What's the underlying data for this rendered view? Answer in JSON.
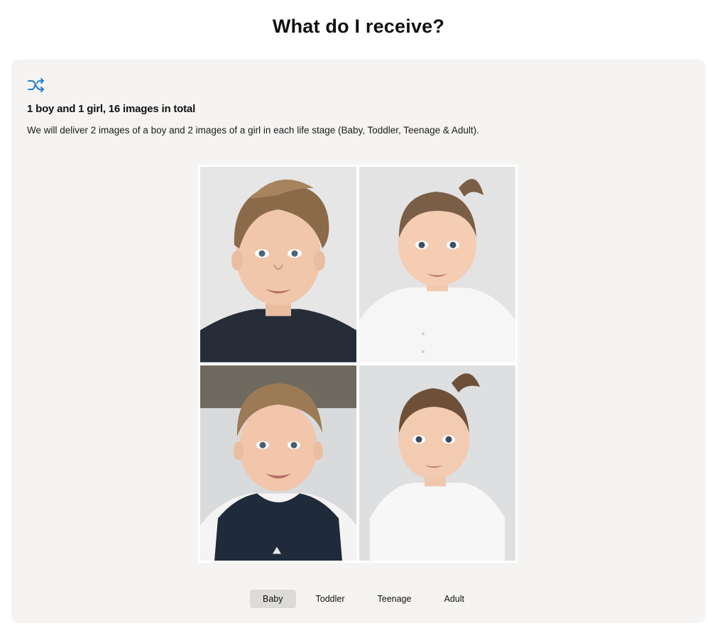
{
  "page": {
    "title": "What do I receive?"
  },
  "card": {
    "icon": "shuffle-icon",
    "heading": "1 boy and 1 girl, 16 images in total",
    "description": "We will deliver 2 images of a boy and 2 images of a girl in each life stage (Baby, Toddler, Teenage & Adult)."
  },
  "gallery": {
    "photos": [
      {
        "subject": "boy",
        "shirt": "navy crew-neck t-shirt"
      },
      {
        "subject": "girl",
        "shirt": "white button blouse"
      },
      {
        "subject": "boy",
        "shirt": "navy vest over white shirt"
      },
      {
        "subject": "girl",
        "shirt": "white dress"
      }
    ]
  },
  "tabs": {
    "items": [
      {
        "label": "Baby",
        "active": true
      },
      {
        "label": "Toddler",
        "active": false
      },
      {
        "label": "Teenage",
        "active": false
      },
      {
        "label": "Adult",
        "active": false
      }
    ]
  },
  "colors": {
    "accent_icon": "#2a7fc6",
    "card_background": "#f5f4f2",
    "active_tab": "#dcdbd9"
  }
}
